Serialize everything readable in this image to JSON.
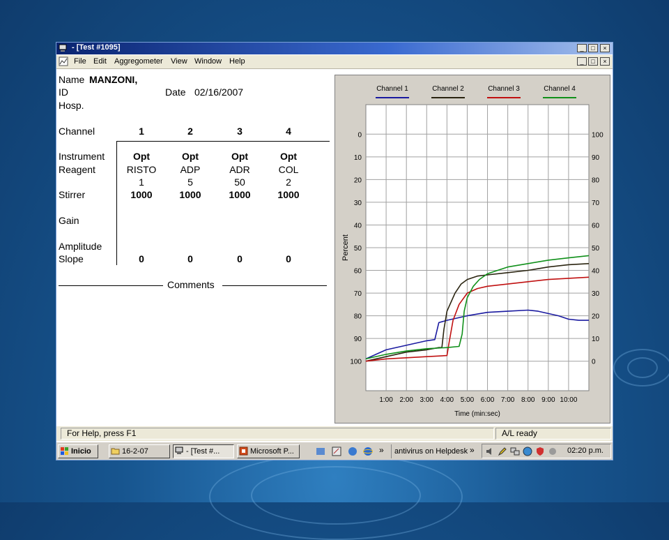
{
  "window": {
    "title": "- [Test #1095]",
    "controls": {
      "min": "_",
      "max": "□",
      "close": "×"
    }
  },
  "menubar": {
    "items": [
      "File",
      "Edit",
      "Aggregometer",
      "View",
      "Window",
      "Help"
    ]
  },
  "patient": {
    "name_label": "Name",
    "name_value": "MANZONI,",
    "id_label": "ID",
    "date_label": "Date",
    "date_value": "02/16/2007",
    "hosp_label": "Hosp."
  },
  "table": {
    "channel_label": "Channel",
    "instrument_label": "Instrument",
    "reagent_label": "Reagent",
    "stirrer_label": "Stirrer",
    "gain_label": "Gain",
    "amplitude_label": "Amplitude",
    "slope_label": "Slope",
    "channels": [
      {
        "num": "1",
        "instrument": "Opt",
        "reagent": "RISTO",
        "dose": "1",
        "stirrer": "1000",
        "slope": "0"
      },
      {
        "num": "2",
        "instrument": "Opt",
        "reagent": "ADP",
        "dose": "5",
        "stirrer": "1000",
        "slope": "0"
      },
      {
        "num": "3",
        "instrument": "Opt",
        "reagent": "ADR",
        "dose": "50",
        "stirrer": "1000",
        "slope": "0"
      },
      {
        "num": "4",
        "instrument": "Opt",
        "reagent": "COL",
        "dose": "2",
        "stirrer": "1000",
        "slope": "0"
      }
    ],
    "comments_label": "Comments"
  },
  "chart_data": {
    "type": "line",
    "xlabel": "Time (min:sec)",
    "ylabel": "Percent",
    "x_ticks": [
      "1:00",
      "2:00",
      "3:00",
      "4:00",
      "5:00",
      "6:00",
      "7:00",
      "8:00",
      "9:00",
      "10:00"
    ],
    "xlim": [
      0,
      11
    ],
    "y_left_ticks": [
      "0",
      "10",
      "20",
      "30",
      "40",
      "50",
      "60",
      "70",
      "80",
      "90",
      "100"
    ],
    "y_right_ticks": [
      "100",
      "90",
      "80",
      "70",
      "60",
      "50",
      "40",
      "30",
      "20",
      "10",
      "0"
    ],
    "ylim_left": [
      -13,
      113
    ],
    "grid": true,
    "legend_position": "top",
    "series": [
      {
        "name": "Channel 1",
        "color": "#1a1aa0",
        "x": [
          0,
          0.5,
          1,
          2,
          3,
          3.4,
          3.6,
          4,
          5,
          6,
          7,
          8,
          8.5,
          9,
          9.5,
          10,
          10.5,
          11
        ],
        "y": [
          99,
          97,
          95,
          93,
          91,
          90.5,
          83,
          82,
          80,
          78.5,
          78,
          77.5,
          78,
          79,
          80,
          81.5,
          82,
          82
        ]
      },
      {
        "name": "Channel 2",
        "color": "#2a2410",
        "x": [
          0,
          1,
          2,
          3,
          3.6,
          3.75,
          3.85,
          4,
          4.2,
          4.4,
          4.7,
          5,
          5.5,
          6,
          7,
          8,
          9,
          10,
          11
        ],
        "y": [
          100,
          98,
          96,
          95,
          94,
          94,
          86,
          78,
          74,
          70,
          66,
          64,
          62.5,
          62,
          61,
          60,
          58.5,
          57.5,
          57
        ]
      },
      {
        "name": "Channel 3",
        "color": "#c01010",
        "x": [
          0,
          1,
          2,
          3,
          4,
          4.1,
          4.3,
          4.6,
          5,
          5.5,
          6,
          6.5,
          7,
          8,
          9,
          10,
          11
        ],
        "y": [
          100,
          99,
          98.5,
          98,
          97.5,
          92,
          82,
          75,
          70,
          68,
          67,
          66.5,
          66,
          65,
          64,
          63.5,
          63
        ]
      },
      {
        "name": "Channel 4",
        "color": "#10901a",
        "x": [
          0,
          1,
          2,
          3,
          4,
          4.6,
          4.75,
          4.85,
          5,
          5.3,
          5.6,
          6,
          6.5,
          7,
          8,
          9,
          10,
          11
        ],
        "y": [
          99,
          97,
          95.5,
          94.5,
          94,
          93.5,
          88,
          78,
          72,
          67,
          64,
          61.5,
          60,
          58.5,
          57,
          55.5,
          54.5,
          53.5
        ]
      }
    ]
  },
  "statusbar": {
    "help": "For Help, press F1",
    "state": "A/L ready"
  },
  "taskbar": {
    "start": "Inicio",
    "buttons": [
      "16-2-07",
      "- [Test #...",
      "Microsoft P..."
    ],
    "chevron": "»",
    "antivirus": "antivirus on Helpdesk",
    "clock": "02:20 p.m."
  }
}
